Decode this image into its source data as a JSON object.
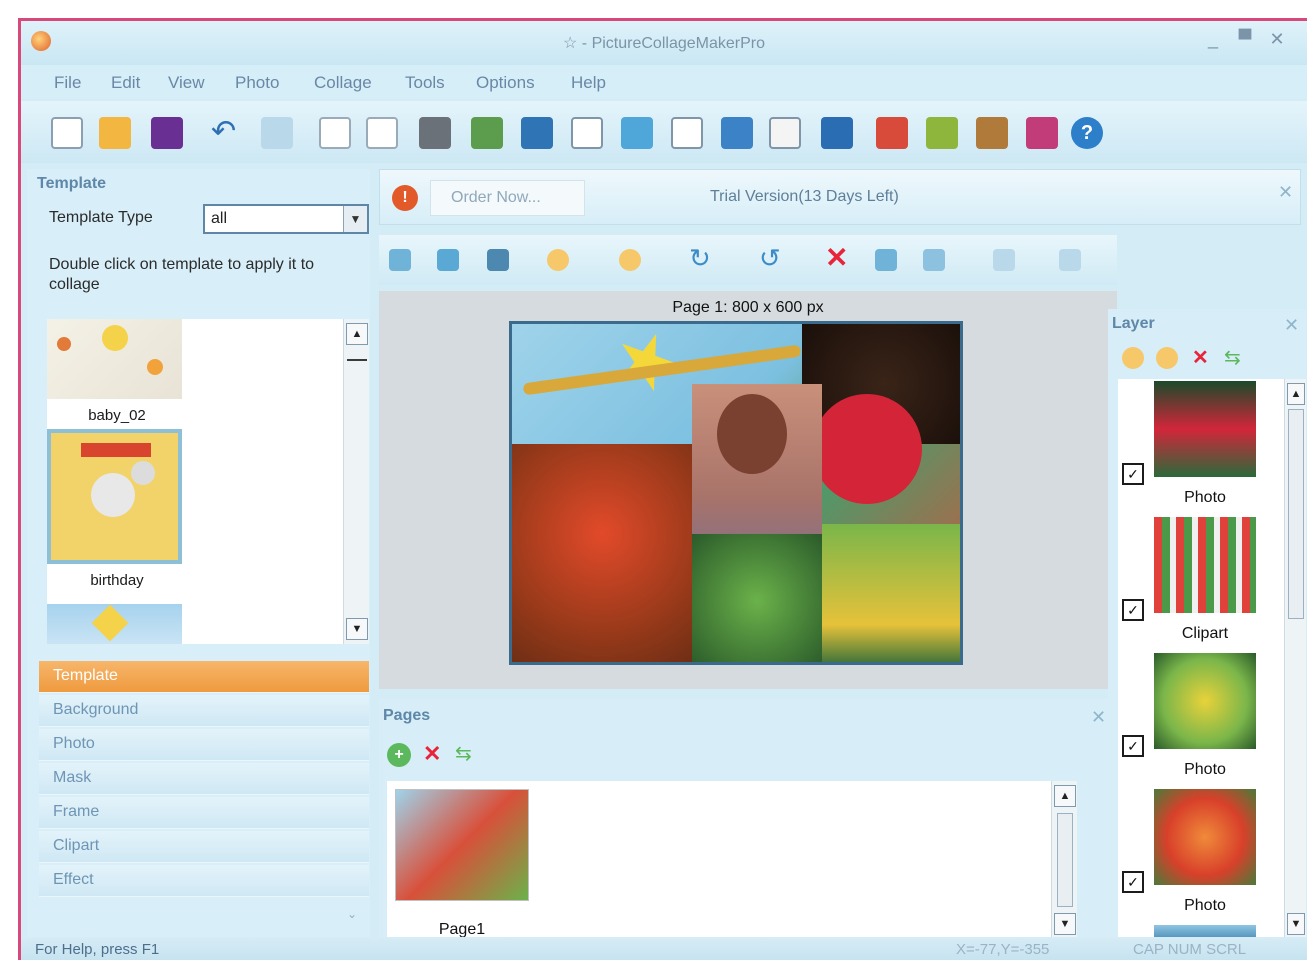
{
  "window": {
    "title": "☆ - PictureCollageMakerPro",
    "controls": [
      "_",
      "▀",
      "✕"
    ]
  },
  "menu": [
    "File",
    "Edit",
    "View",
    "Photo",
    "Collage",
    "Tools",
    "Options",
    "Help"
  ],
  "toolbar_icons": [
    "new-icon",
    "open-icon",
    "save-icon",
    "undo-icon",
    "redo-icon",
    "page-icon",
    "page-setup-icon",
    "print-icon",
    "add-photo-icon",
    "add-clipart-icon",
    "add-text-icon",
    "zoom-icon",
    "export-icon",
    "import-icon",
    "frame-icon",
    "mask-icon",
    "photo-icon",
    "calendar-icon",
    "card-icon",
    "slideshow-icon",
    "help-icon"
  ],
  "left_panel": {
    "title": "Template",
    "type_label": "Template Type",
    "type_value": "all",
    "hint": "Double click on template to apply it to collage",
    "templates": [
      "baby_02",
      "birthday"
    ],
    "sections": [
      "Template",
      "Background",
      "Photo",
      "Mask",
      "Frame",
      "Clipart",
      "Effect"
    ]
  },
  "order": {
    "button": "Order Now...",
    "info": "Trial Version(13 Days Left)"
  },
  "canvas": {
    "caption": "Page 1: 800 x 600 px"
  },
  "pages": {
    "title": "Pages",
    "items": [
      "Page1"
    ]
  },
  "layer": {
    "title": "Layer",
    "items": [
      {
        "label": "Photo",
        "checked": true
      },
      {
        "label": "Clipart",
        "checked": true
      },
      {
        "label": "Photo",
        "checked": true
      },
      {
        "label": "Photo",
        "checked": true
      }
    ]
  },
  "status": {
    "help": "For Help, press F1",
    "coords": "X=-77,Y=-355",
    "keys": "CAP NUM SCRL"
  },
  "colors": {
    "accent": "#ef9a3e",
    "window_border": "#d9487a",
    "panel_bg": "#d7eef8"
  }
}
